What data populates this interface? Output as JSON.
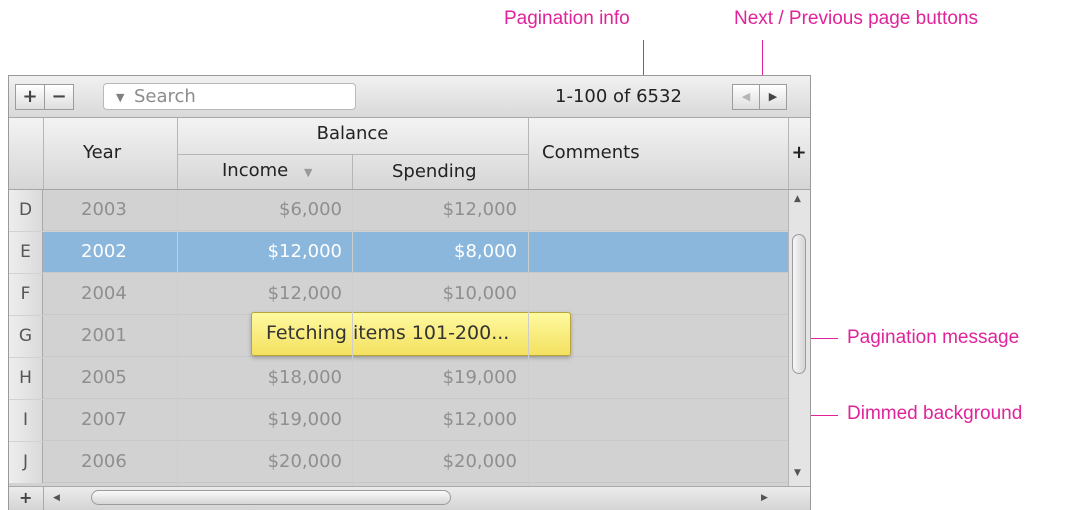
{
  "annotations": {
    "pagination_info": "Pagination info",
    "next_prev": "Next / Previous page buttons",
    "pagination_message": "Pagination message",
    "dimmed_background": "Dimmed background"
  },
  "toolbar": {
    "add_label": "+",
    "remove_label": "−",
    "search_placeholder": "Search",
    "page_info": "1-100 of 6532",
    "prev_icon": "◀",
    "next_icon": "▶"
  },
  "header": {
    "corner_label": "",
    "year": "Year",
    "balance": "Balance",
    "income": "Income",
    "sort_icon": "▼",
    "spending": "Spending",
    "comments": "Comments",
    "add_column": "+"
  },
  "rows": [
    {
      "id": "D",
      "year": "2003",
      "income": "$6,000",
      "spending": "$12,000",
      "comments": "",
      "selected": false
    },
    {
      "id": "E",
      "year": "2002",
      "income": "$12,000",
      "spending": "$8,000",
      "comments": "",
      "selected": true
    },
    {
      "id": "F",
      "year": "2004",
      "income": "$12,000",
      "spending": "$10,000",
      "comments": "",
      "selected": false
    },
    {
      "id": "G",
      "year": "2001",
      "income": "",
      "spending": "",
      "comments": "",
      "selected": false
    },
    {
      "id": "H",
      "year": "2005",
      "income": "$18,000",
      "spending": "$19,000",
      "comments": "",
      "selected": false
    },
    {
      "id": "I",
      "year": "2007",
      "income": "$19,000",
      "spending": "$12,000",
      "comments": "",
      "selected": false
    },
    {
      "id": "J",
      "year": "2006",
      "income": "$20,000",
      "spending": "$20,000",
      "comments": "",
      "selected": false
    }
  ],
  "footer": {
    "add_row": "+"
  },
  "tooltip": {
    "text": "Fetching items 101-200..."
  },
  "colors": {
    "annotation": "#e0239b",
    "selection": "#8bb7dc",
    "tooltip": "#fbf07e"
  }
}
